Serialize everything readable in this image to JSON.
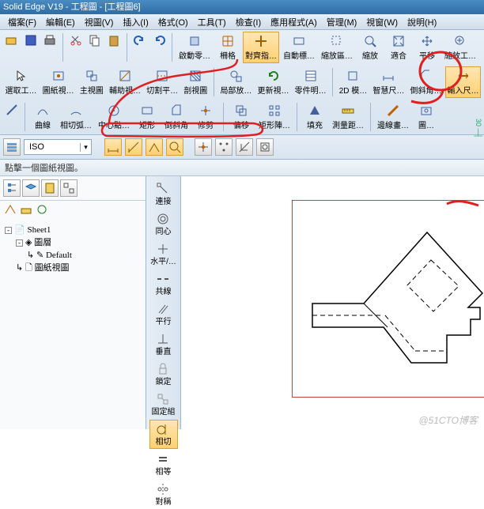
{
  "title": "Solid Edge V19 - 工程圖 - [工程圖6]",
  "menus": [
    "檔案(F)",
    "編輯(E)",
    "視圖(V)",
    "插入(I)",
    "格式(O)",
    "工具(T)",
    "檢查(I)",
    "應用程式(A)",
    "管理(M)",
    "視窗(W)",
    "說明(H)"
  ],
  "smallbar": [
    "open",
    "save",
    "print",
    "cut",
    "copy",
    "paste",
    "undo",
    "redo"
  ],
  "ribbon1": [
    {
      "id": "startpart",
      "label": "啟動零…"
    },
    {
      "id": "grid",
      "label": "柵格"
    },
    {
      "id": "align",
      "label": "對齊指…",
      "active": true
    },
    {
      "id": "autoalign",
      "label": "自動標…"
    },
    {
      "id": "zoomarea",
      "label": "縮放區…"
    },
    {
      "id": "zoom",
      "label": "縮放"
    },
    {
      "id": "fit",
      "label": "適合"
    },
    {
      "id": "pan",
      "label": "平移"
    },
    {
      "id": "zoomtool",
      "label": "縮放工…"
    }
  ],
  "ribbon2": [
    {
      "id": "selecttool",
      "label": "選取工…"
    },
    {
      "id": "drawingview",
      "label": "圖紙視…"
    },
    {
      "id": "mainview",
      "label": "主視圖"
    },
    {
      "id": "auxview",
      "label": "輔助視…"
    },
    {
      "id": "sectionview",
      "label": "切割平…"
    },
    {
      "id": "section",
      "label": "剖視圖"
    },
    {
      "id": "detailzoom",
      "label": "局部放…"
    },
    {
      "id": "updateview",
      "label": "更新視…"
    },
    {
      "id": "partlist",
      "label": "零件明…"
    },
    {
      "id": "2dmodel",
      "label": "2D 模…"
    },
    {
      "id": "smartdim",
      "label": "智慧尺…"
    },
    {
      "id": "chamfer",
      "label": "倒斜角…"
    },
    {
      "id": "insertdim",
      "label": "輸入尺…",
      "active": true
    }
  ],
  "ribbon3": [
    {
      "id": "curve",
      "label": "曲線"
    },
    {
      "id": "intersect",
      "label": "相切弧…"
    },
    {
      "id": "centerpt",
      "label": "中心點…"
    },
    {
      "id": "rect",
      "label": "矩形"
    },
    {
      "id": "chamfer2",
      "label": "倒斜角"
    },
    {
      "id": "trim",
      "label": "修剪"
    },
    {
      "id": "offset",
      "label": "偏移"
    },
    {
      "id": "rectpattern",
      "label": "矩形陣…"
    },
    {
      "id": "fill",
      "label": "填充"
    },
    {
      "id": "measure",
      "label": "測量距…"
    },
    {
      "id": "edgepaint",
      "label": "邊線畫…"
    },
    {
      "id": "imgcapture",
      "label": "圖…"
    }
  ],
  "layerDropdown": {
    "value": "ISO"
  },
  "toolrow": [
    "preset",
    "t1",
    "t2",
    "t3",
    "t4",
    "t5",
    "t6",
    "t7",
    "t8"
  ],
  "statusHint": "點擊一個圖紙視圖。",
  "tree": {
    "root": "Sheet1",
    "children": [
      {
        "label": "圖層",
        "children": [
          {
            "label": "Default"
          }
        ]
      },
      {
        "label": "圖紙視圖"
      }
    ]
  },
  "vtools": [
    {
      "id": "connect",
      "label": "連接"
    },
    {
      "id": "concentric",
      "label": "同心"
    },
    {
      "id": "horizvert",
      "label": "水平/…"
    },
    {
      "id": "collinear",
      "label": "共線"
    },
    {
      "id": "parallel",
      "label": "平行"
    },
    {
      "id": "perpendicular",
      "label": "垂直"
    },
    {
      "id": "lock",
      "label": "鎖定"
    },
    {
      "id": "rigidset",
      "label": "固定組"
    },
    {
      "id": "tangent",
      "label": "相切",
      "active": true
    },
    {
      "id": "equal",
      "label": "相等"
    },
    {
      "id": "symmetric",
      "label": "對稱"
    }
  ],
  "rulerRight": "30",
  "watermark": "@51CTO博客"
}
